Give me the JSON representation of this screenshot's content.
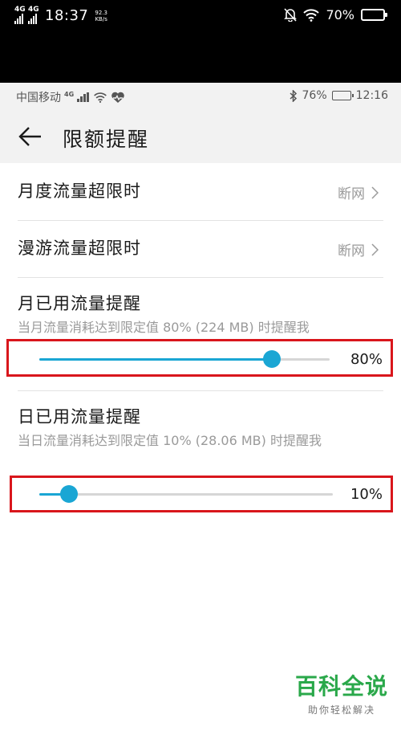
{
  "outer_status": {
    "sig1_tag": "4G",
    "sig2_tag": "4G",
    "time": "18:37",
    "speed_value": "92.3",
    "speed_unit": "KB/s",
    "battery_pct": "70%",
    "battery_level": 0.7
  },
  "inner_status": {
    "carrier": "中国移动",
    "net_tag": "4G",
    "battery_pct": "76%",
    "battery_level": 0.76,
    "time": "12:16"
  },
  "header": {
    "title": "限额提醒"
  },
  "rows": {
    "monthly_limit": {
      "label": "月度流量超限时",
      "value": "断网"
    },
    "roaming_limit": {
      "label": "漫游流量超限时",
      "value": "断网"
    }
  },
  "monthly_reminder": {
    "title": "月已用流量提醒",
    "desc": "当月流量消耗达到限定值 80% (224 MB) 时提醒我",
    "percent_label": "80%",
    "level": 0.8
  },
  "daily_reminder": {
    "title": "日已用流量提醒",
    "desc": "当日流量消耗达到限定值 10% (28.06 MB) 时提醒我",
    "percent_label": "10%",
    "level": 0.1
  },
  "watermark": {
    "main": "百科全说",
    "sub": "助你轻松解决"
  },
  "colors": {
    "accent": "#1aa6d4",
    "highlight": "#d9161c",
    "brand": "#2aa84a"
  }
}
